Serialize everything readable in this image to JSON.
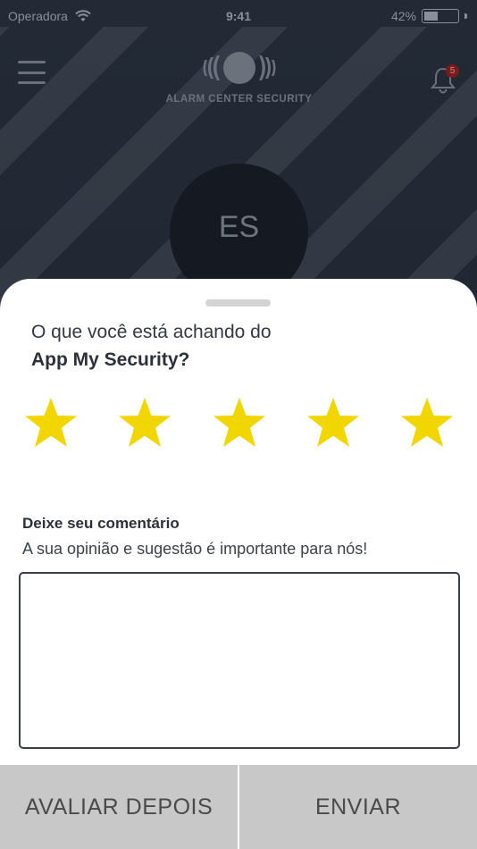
{
  "status_bar": {
    "carrier": "Operadora",
    "time": "9:41",
    "battery_percent": "42%",
    "battery_level": 0.42
  },
  "header": {
    "brand": "ALARM CENTER SECURITY",
    "notification_count": "5"
  },
  "profile": {
    "initials": "ES"
  },
  "rating_sheet": {
    "question_line1": "O que você está achando do",
    "question_line2": "App My Security?",
    "stars_total": 5,
    "stars_selected": 5,
    "star_color": "#f2d600",
    "comment_title": "Deixe seu comentário",
    "comment_subtitle": "A sua opinião e sugestão é importante para nós!",
    "comment_value": "",
    "later_label": "AVALIAR DEPOIS",
    "send_label": "ENVIAR"
  },
  "icons": [
    "wifi-icon",
    "battery-icon",
    "menu-icon",
    "logo-icon",
    "bell-icon",
    "star-icon"
  ]
}
